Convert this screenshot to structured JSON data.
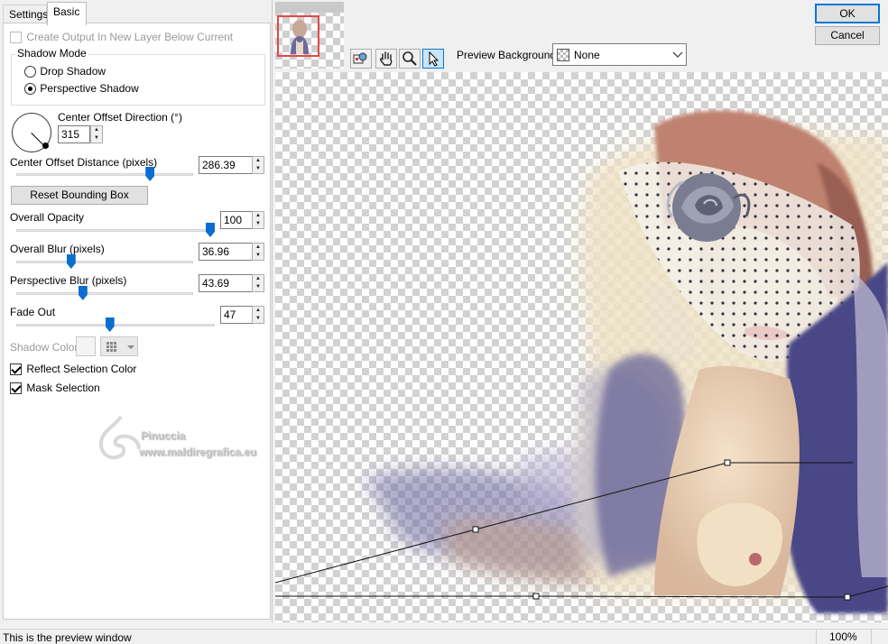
{
  "tabs": [
    {
      "label": "Settings",
      "active": false
    },
    {
      "label": "Basic",
      "active": true
    }
  ],
  "create_output": {
    "label": "Create Output In New Layer Below Current",
    "checked": false,
    "enabled": false
  },
  "shadow_mode": {
    "title": "Shadow Mode",
    "options": [
      {
        "label": "Drop Shadow",
        "selected": false
      },
      {
        "label": "Perspective Shadow",
        "selected": true
      }
    ]
  },
  "center_offset_direction": {
    "label": "Center Offset Direction (°)",
    "value": "315"
  },
  "center_offset_distance": {
    "label": "Center Offset Distance (pixels)",
    "value": "286.39",
    "slider_fraction": 0.77
  },
  "reset_bounding_box": {
    "label": "Reset Bounding Box"
  },
  "overall_opacity": {
    "label": "Overall Opacity",
    "value": "100",
    "slider_fraction": 1.0
  },
  "overall_blur": {
    "label": "Overall Blur (pixels)",
    "value": "36.96",
    "slider_fraction": 0.3
  },
  "perspective_blur": {
    "label": "Perspective Blur (pixels)",
    "value": "43.69",
    "slider_fraction": 0.37
  },
  "fade_out": {
    "label": "Fade Out",
    "value": "47",
    "slider_fraction": 0.47
  },
  "shadow_color": {
    "label": "Shadow Color",
    "enabled": false
  },
  "reflect_selection_color": {
    "label": "Reflect Selection Color",
    "checked": true
  },
  "mask_selection": {
    "label": "Mask Selection",
    "checked": true
  },
  "watermark": {
    "line1": "Pinuccia",
    "line2": "www.maldiregrafica.eu"
  },
  "preview_background": {
    "label": "Preview Background:",
    "value": "None"
  },
  "buttons": {
    "ok": "OK",
    "cancel": "Cancel"
  },
  "status": {
    "text": "This is the preview window",
    "zoom": "100%"
  },
  "colors": {
    "accent": "#0a6ed1",
    "thumb_frame": "#e04848",
    "dialog_bg": "#f0f0f0"
  }
}
